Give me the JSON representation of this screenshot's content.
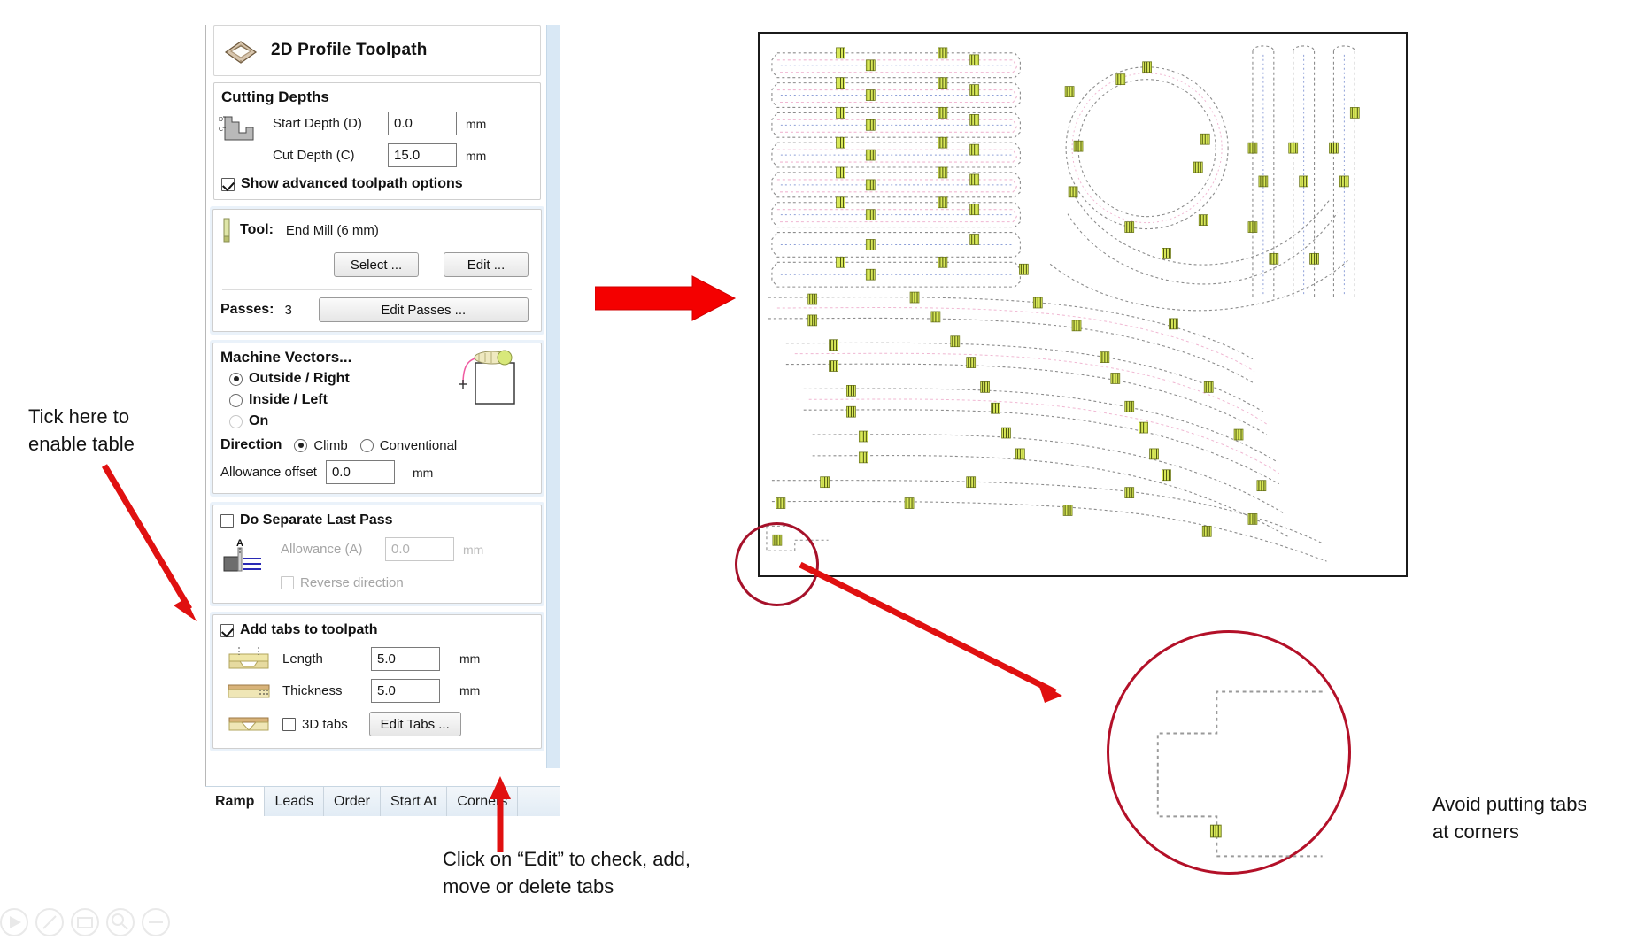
{
  "app": {
    "panel_title": "2D Profile Toolpath",
    "title_icon": "profile-toolpath-icon"
  },
  "cutting_depths": {
    "heading": "Cutting Depths",
    "start_depth_label": "Start Depth (D)",
    "start_depth_value": "0.0",
    "start_depth_unit": "mm",
    "cut_depth_label": "Cut Depth (C)",
    "cut_depth_value": "15.0",
    "cut_depth_unit": "mm",
    "advanced_label": "Show advanced toolpath options",
    "advanced_checked": true
  },
  "tool": {
    "label": "Tool:",
    "name": "End Mill (6 mm)",
    "select_button": "Select ...",
    "edit_button": "Edit ...",
    "passes_label": "Passes:",
    "passes_value": "3",
    "edit_passes_button": "Edit Passes ..."
  },
  "machine_vectors": {
    "heading": "Machine Vectors...",
    "options": [
      {
        "label": "Outside / Right",
        "selected": true
      },
      {
        "label": "Inside / Left",
        "selected": false
      },
      {
        "label": "On",
        "selected": false
      }
    ],
    "direction_label": "Direction",
    "direction_options": [
      {
        "label": "Climb",
        "selected": true
      },
      {
        "label": "Conventional",
        "selected": false
      }
    ],
    "allowance_offset_label": "Allowance offset",
    "allowance_offset_value": "0.0",
    "allowance_offset_unit": "mm"
  },
  "last_pass": {
    "heading": "Do Separate Last Pass",
    "checked": false,
    "allowance_label": "Allowance (A)",
    "allowance_value": "0.0",
    "allowance_unit": "mm",
    "reverse_label": "Reverse direction",
    "reverse_checked": false
  },
  "tabs_section": {
    "heading": "Add tabs to toolpath",
    "checked": true,
    "length_label": "Length",
    "length_value": "5.0",
    "length_unit": "mm",
    "thickness_label": "Thickness",
    "thickness_value": "5.0",
    "thickness_unit": "mm",
    "three_d_label": "3D tabs",
    "three_d_checked": false,
    "edit_tabs_button": "Edit Tabs ..."
  },
  "bottom_tabs": [
    {
      "label": "Ramp",
      "selected": true
    },
    {
      "label": "Leads",
      "selected": false
    },
    {
      "label": "Order",
      "selected": false
    },
    {
      "label": "Start At",
      "selected": false
    },
    {
      "label": "Corners",
      "selected": false
    }
  ],
  "annotations": {
    "enable_tabs": "Tick here to\nenable table",
    "edit_tabs": "Click on “Edit” to check, add,\nmove or delete tabs",
    "avoid_corners": "Avoid putting tabs\nat corners"
  },
  "colors": {
    "arrow_red": "#f40000",
    "circle_red": "#b31028",
    "tab_marker": "#d4e14a",
    "panel_blue": "#d9e8f5",
    "toolpath_grey": "#8c8c8c",
    "toolpath_pink": "#f6c8dd",
    "toolpath_blue": "#8ea0d8"
  }
}
